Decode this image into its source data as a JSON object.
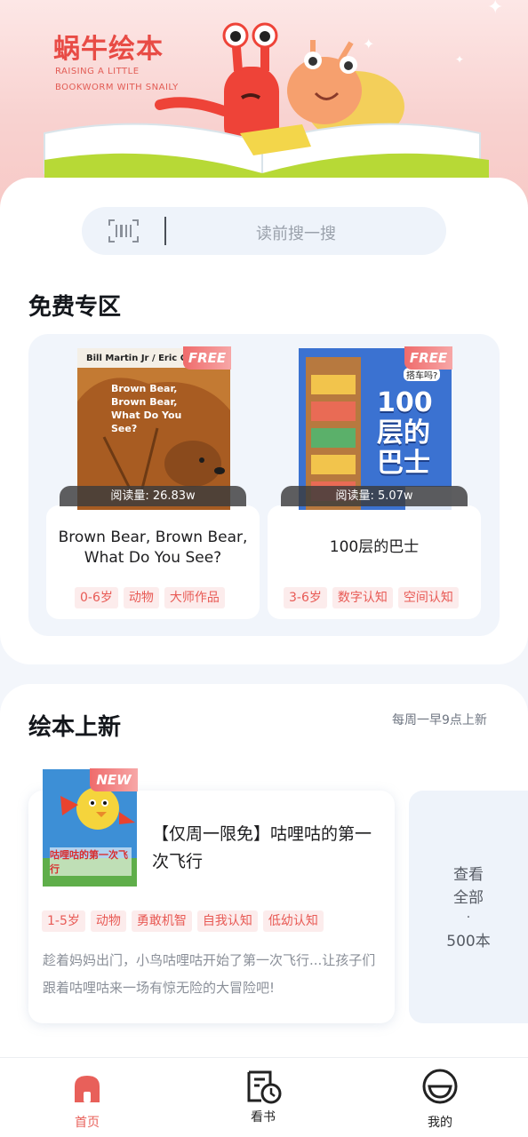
{
  "banner": {
    "brand_title": "蜗牛绘本",
    "brand_subtitle": "RAISING A LITTLE BOOKWORM WITH SNAILY"
  },
  "search": {
    "placeholder": "读前搜一搜",
    "icon": "barcode-scan-icon"
  },
  "free_section": {
    "title": "免费专区",
    "books": [
      {
        "cover_text": "Brown Bear, Brown Bear, What Do You See?",
        "cover_author": "Bill Martin Jr / Eric Ca",
        "badge": "FREE",
        "reads": "阅读量: 26.83w",
        "title": "Brown Bear, Brown Bear, What Do You See?",
        "tags": [
          "0-6岁",
          "动物",
          "大师作品"
        ]
      },
      {
        "cover_text": "100层的巴士",
        "cover_small": "搭车吗?",
        "badge": "FREE",
        "reads": "阅读量: 5.07w",
        "title": "100层的巴士",
        "tags": [
          "3-6岁",
          "数字认知",
          "空间认知"
        ]
      }
    ]
  },
  "new_section": {
    "title": "绘本上新",
    "note": "每周一早9点上新",
    "book": {
      "badge": "NEW",
      "cover_text": "咕哩咕的第一次飞行",
      "title": "【仅周一限免】咕哩咕的第一次飞行",
      "tags": [
        "1-5岁",
        "动物",
        "勇敢机智",
        "自我认知",
        "低幼认知"
      ],
      "description": "趁着妈妈出门，小鸟咕哩咕开始了第一次飞行...让孩子们跟着咕哩咕来一场有惊无险的大冒险吧!"
    },
    "view_all": {
      "line1": "查看",
      "line2": "全部",
      "dot": "·",
      "count": "500本"
    }
  },
  "bottom_nav": {
    "items": [
      {
        "label": "首页",
        "icon": "home-icon",
        "active": true
      },
      {
        "label": "看书",
        "icon": "book-clock-icon",
        "active": false
      },
      {
        "label": "我的",
        "icon": "smile-face-icon",
        "active": false
      }
    ]
  },
  "colors": {
    "accent": "#e85a55",
    "tag_bg": "#fcecec",
    "nav_active": "#e8605a",
    "nav_inactive": "#222222"
  }
}
